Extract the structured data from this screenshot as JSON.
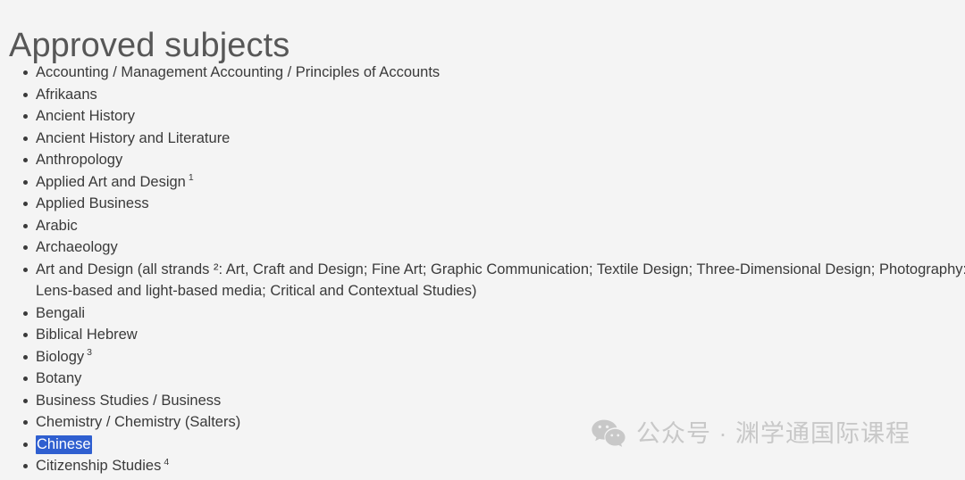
{
  "page": {
    "title": "Approved subjects",
    "background_color": "#f4f4f4",
    "text_color": "#3a3a3a",
    "title_color": "#575757",
    "selection_color": "#2f5fd0",
    "selection_text_color": "#ffffff"
  },
  "subjects": [
    {
      "text": "Accounting / Management Accounting / Principles of Accounts",
      "sup": "",
      "selected": false
    },
    {
      "text": "Afrikaans",
      "sup": "",
      "selected": false
    },
    {
      "text": "Ancient History",
      "sup": "",
      "selected": false
    },
    {
      "text": "Ancient History and Literature",
      "sup": "",
      "selected": false
    },
    {
      "text": "Anthropology",
      "sup": "",
      "selected": false
    },
    {
      "text": "Applied Art and Design",
      "sup": "1",
      "selected": false
    },
    {
      "text": "Applied Business",
      "sup": "",
      "selected": false
    },
    {
      "text": "Arabic",
      "sup": "",
      "selected": false
    },
    {
      "text": "Archaeology",
      "sup": "",
      "selected": false
    },
    {
      "text": "Art and Design (all strands ²: Art, Craft and Design; Fine Art; Graphic Communication; Textile Design; Three-Dimensional Design; Photography: Lens-based and light-based media; Critical and Contextual Studies)",
      "sup": "",
      "selected": false
    },
    {
      "text": "Bengali",
      "sup": "",
      "selected": false
    },
    {
      "text": "Biblical Hebrew",
      "sup": "",
      "selected": false
    },
    {
      "text": "Biology",
      "sup": "3",
      "selected": false
    },
    {
      "text": "Botany",
      "sup": "",
      "selected": false
    },
    {
      "text": "Business Studies / Business",
      "sup": "",
      "selected": false
    },
    {
      "text": "Chemistry / Chemistry (Salters)",
      "sup": "",
      "selected": false
    },
    {
      "text": "Chinese",
      "sup": "",
      "selected": true
    },
    {
      "text": "Citizenship Studies",
      "sup": "4",
      "selected": false
    }
  ],
  "watermark": {
    "icon": "wechat-icon",
    "text": "公众号 · 渊学通国际课程",
    "color": "#c8c8c8"
  }
}
